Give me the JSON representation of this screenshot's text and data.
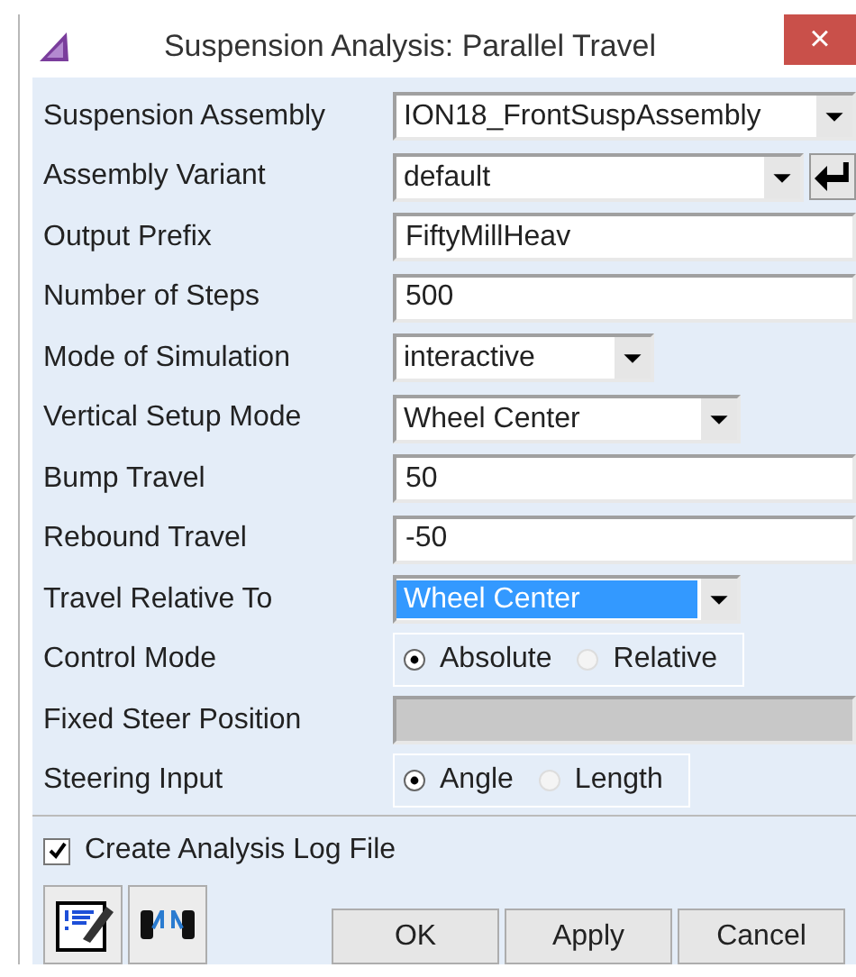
{
  "window": {
    "title": "Suspension Analysis: Parallel Travel",
    "close": "×"
  },
  "rows": [
    {
      "label": "Suspension Assembly",
      "kind": "dropdown",
      "value": "ION18_FrontSuspAssembly"
    },
    {
      "label": "Assembly Variant",
      "kind": "dropdown-enter",
      "value": "default"
    },
    {
      "label": "Output Prefix",
      "kind": "text",
      "value": "FiftyMillHeav"
    },
    {
      "label": "Number of Steps",
      "kind": "text",
      "value": "500"
    },
    {
      "label": "Mode of Simulation",
      "kind": "dropdown-short",
      "value": "interactive"
    },
    {
      "label": "Vertical Setup Mode",
      "kind": "dropdown-medium",
      "value": "Wheel Center"
    },
    {
      "label": "Bump Travel",
      "kind": "text",
      "value": "50"
    },
    {
      "label": "Rebound Travel",
      "kind": "text",
      "value": "-50"
    },
    {
      "label": "Travel Relative To",
      "kind": "dropdown-medium",
      "value": "Wheel Center",
      "highlighted": true
    },
    {
      "label": "Control Mode",
      "kind": "radio",
      "options": [
        {
          "label": "Absolute",
          "selected": true
        },
        {
          "label": "Relative",
          "selected": false
        }
      ]
    },
    {
      "label": "Fixed Steer Position",
      "kind": "text",
      "disabled": true
    },
    {
      "label": "Steering Input",
      "kind": "radio",
      "options": [
        {
          "label": "Angle",
          "selected": true
        },
        {
          "label": "Length",
          "selected": false
        }
      ]
    }
  ],
  "log_file": {
    "label": "Create Analysis Log File",
    "checked": true
  },
  "buttons": [
    "OK",
    "Apply",
    "Cancel"
  ]
}
